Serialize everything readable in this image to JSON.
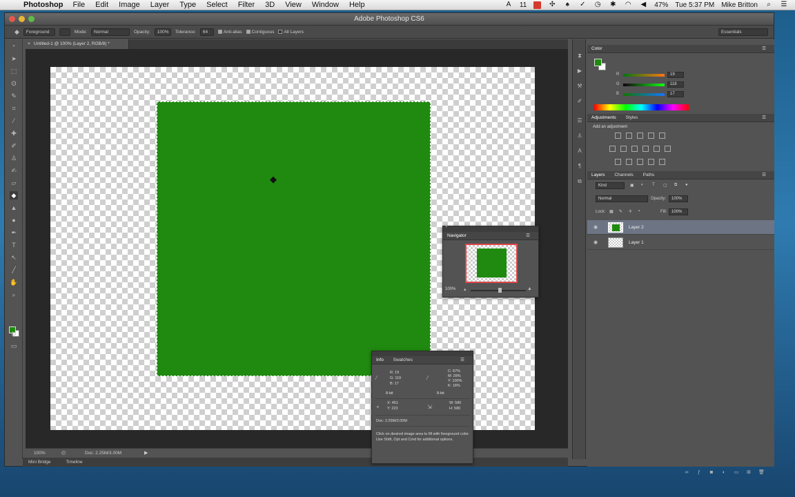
{
  "menubar": {
    "app_name": "Photoshop",
    "menus": [
      "File",
      "Edit",
      "Image",
      "Layer",
      "Type",
      "Select",
      "Filter",
      "3D",
      "View",
      "Window",
      "Help"
    ],
    "status_icons": [
      "adobe-cc-icon",
      "dropbox-icon",
      "evernote-icon",
      "bell-icon",
      "check-icon",
      "bluetooth-icon",
      "wifi-icon",
      "volume-icon"
    ],
    "notif_count": "11",
    "battery": "47%",
    "clock": "Tue 5:37 PM",
    "user": "Mike Britton"
  },
  "window": {
    "title": "Adobe Photoshop CS6"
  },
  "options": {
    "fill_source": "Foreground",
    "mode_label": "Mode:",
    "mode_value": "Normal",
    "opacity_label": "Opacity:",
    "opacity_value": "100%",
    "tolerance_label": "Tolerance:",
    "tolerance_value": "64",
    "anti_alias": "Anti-alias",
    "contiguous": "Contiguous",
    "all_layers": "All Layers",
    "workspace": "Essentials"
  },
  "document": {
    "tab_title": "Untitled-1 @ 100% (Layer 2, RGB/8) *",
    "fill_color": "#1f8a0f",
    "zoom": "100%",
    "doc_size": "Doc: 2.25M/3.00M"
  },
  "bottom_tabs": [
    "Mini Bridge",
    "Timeline"
  ],
  "color_panel": {
    "tab": "Color",
    "channels": [
      {
        "label": "R",
        "value": "19"
      },
      {
        "label": "G",
        "value": "118"
      },
      {
        "label": "B",
        "value": "17"
      }
    ]
  },
  "adjustments": {
    "tabs": [
      "Adjustments",
      "Styles"
    ],
    "hint": "Add an adjustment"
  },
  "layers_panel": {
    "tabs": [
      "Layers",
      "Channels",
      "Paths"
    ],
    "filter": "Kind",
    "blend_mode": "Normal",
    "opacity_label": "Opacity:",
    "opacity_value": "100%",
    "lock_label": "Lock:",
    "fill_label": "Fill:",
    "fill_value": "100%",
    "layers": [
      {
        "name": "Layer 2",
        "selected": true
      },
      {
        "name": "Layer 1",
        "selected": false
      }
    ]
  },
  "navigator": {
    "title": "Navigator",
    "zoom": "100%"
  },
  "info_panel": {
    "tabs": [
      "Info",
      "Swatches"
    ],
    "rgb": {
      "r": "19",
      "g": "119",
      "b": "17"
    },
    "cmyk": {
      "c": "87%",
      "m": "28%",
      "y": "100%",
      "k": "18%"
    },
    "bit_left": "8-bit",
    "bit_right": "8-bit",
    "x": "451",
    "y": "223",
    "w": "580",
    "h": "580",
    "doc": "Doc: 2.25M/3.00M",
    "hint": "Click on desired image area to fill with foreground color. Use Shift, Opt and Cmd for additional options."
  }
}
